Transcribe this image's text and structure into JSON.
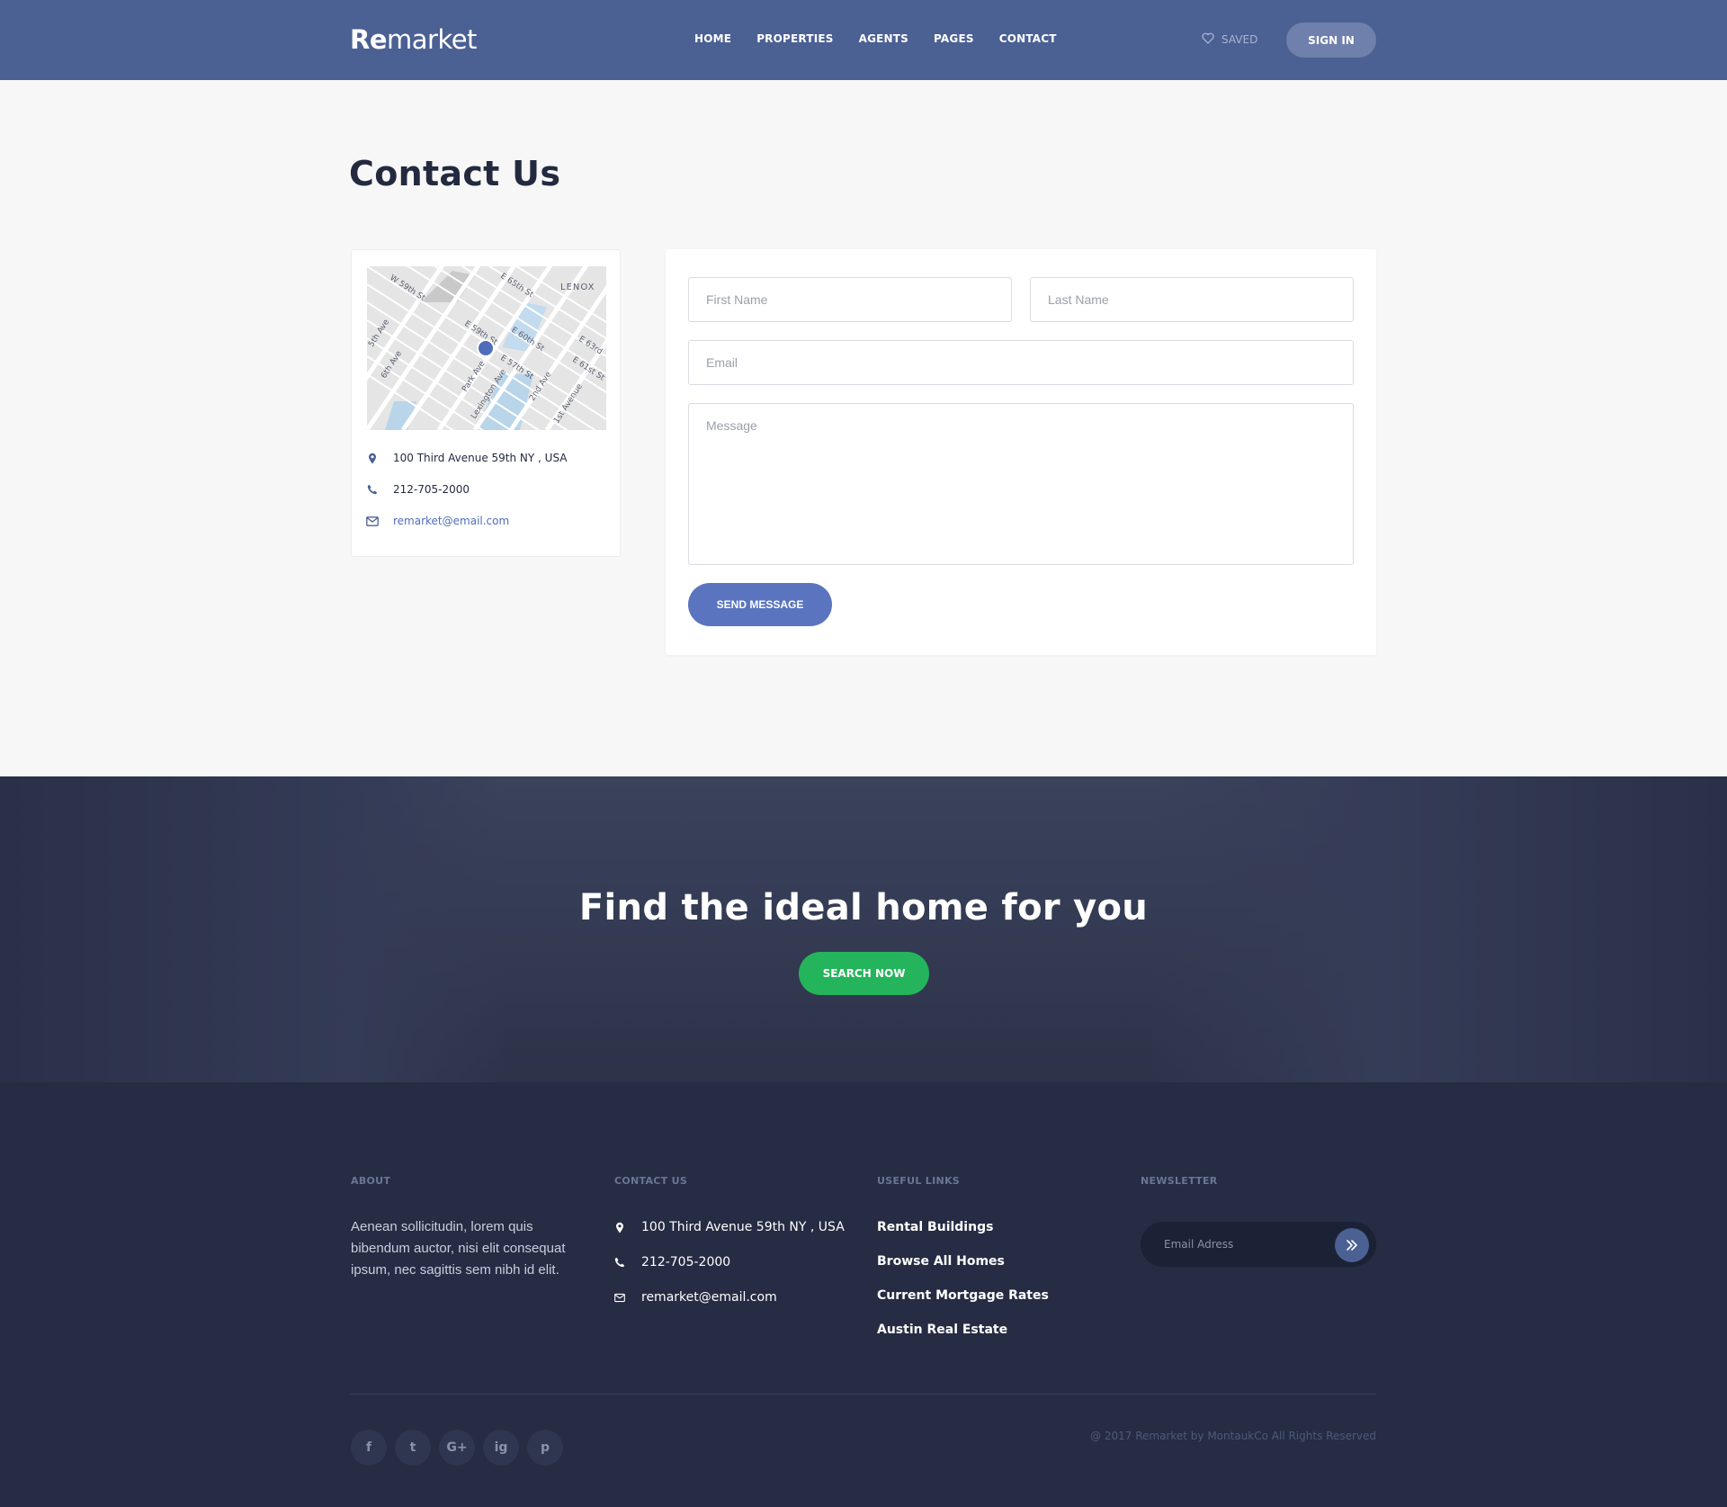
{
  "header": {
    "logo_bold": "Re",
    "logo_rest": "market",
    "nav": [
      "HOME",
      "PROPERTIES",
      "AGENTS",
      "PAGES",
      "CONTACT"
    ],
    "saved_label": "SAVED",
    "signin_label": "SIGN IN"
  },
  "page": {
    "title": "Contact Us"
  },
  "info_card": {
    "map_labels": [
      "LENOX",
      "E 59th St",
      "E 60th St",
      "E 57th St",
      "E 61st St",
      "E 63rd",
      "W 59th St",
      "E 65th St",
      "6th Ave",
      "5th Ave",
      "Park Ave",
      "Lexington Ave",
      "2nd Ave",
      "1st Avenue"
    ],
    "address": "100 Third Avenue 59th NY , USA",
    "phone": "212-705-2000",
    "email": "remarket@email.com"
  },
  "form": {
    "first_name_placeholder": "First Name",
    "last_name_placeholder": "Last Name",
    "email_placeholder": "Email",
    "message_placeholder": "Message",
    "submit_label": "SEND MESSAGE"
  },
  "banner": {
    "title": "Find the ideal home for you",
    "button_label": "SEARCH NOW"
  },
  "footer": {
    "about_title": "ABOUT",
    "about_text": "Aenean sollicitudin, lorem quis bibendum auctor, nisi elit consequat ipsum, nec sagittis sem nibh id elit.",
    "contact_title": "CONTACT US",
    "address": "100 Third Avenue 59th NY , USA",
    "phone": "212-705-2000",
    "email": "remarket@email.com",
    "links_title": "USEFUL LINKS",
    "links": [
      "Rental Buildings",
      "Browse All Homes",
      "Current Mortgage Rates",
      "Austin Real Estate"
    ],
    "newsletter_title": "NEWSLETTER",
    "newsletter_placeholder": "Email Adress",
    "socials": [
      "f",
      "t",
      "G+",
      "ig",
      "p"
    ],
    "copyright": "@ 2017 Remarket by MontaukCo All Rights Reserved"
  },
  "colors": {
    "header_bg": "#4b6093",
    "accent_blue": "#5a74bf",
    "green": "#24b45b",
    "footer_bg": "#252c43"
  }
}
